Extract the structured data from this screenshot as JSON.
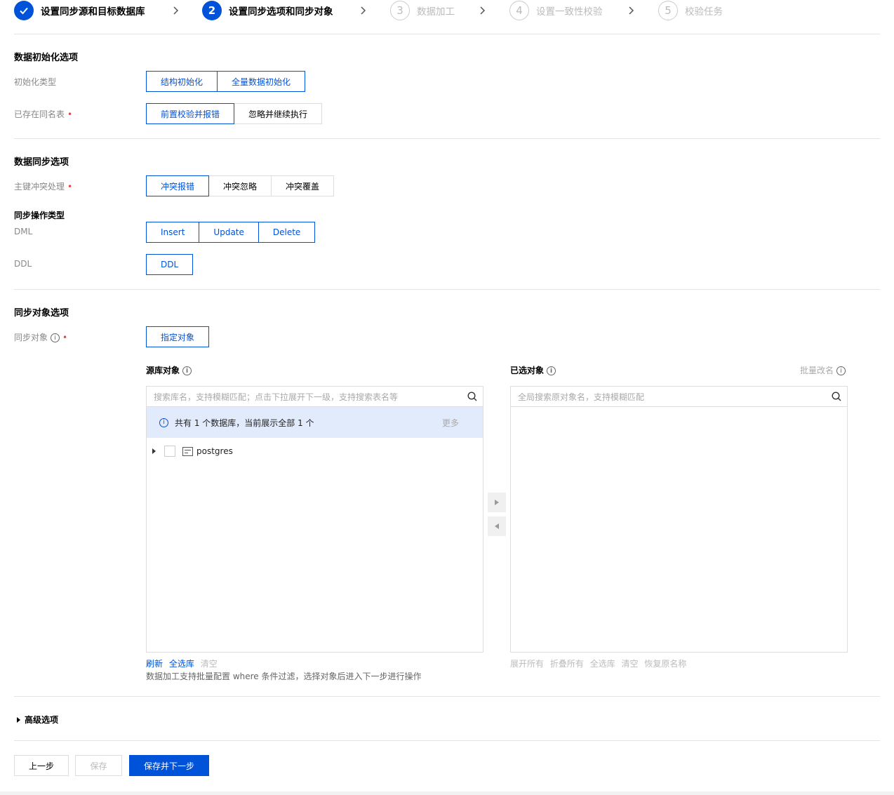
{
  "steps": [
    {
      "num": "✓",
      "label": "设置同步源和目标数据库",
      "state": "done"
    },
    {
      "num": "2",
      "label": "设置同步选项和同步对象",
      "state": "active"
    },
    {
      "num": "3",
      "label": "数据加工",
      "state": "todo"
    },
    {
      "num": "4",
      "label": "设置一致性校验",
      "state": "todo"
    },
    {
      "num": "5",
      "label": "校验任务",
      "state": "todo"
    }
  ],
  "init_section": {
    "title": "数据初始化选项",
    "init_type_label": "初始化类型",
    "init_type_options": [
      "结构初始化",
      "全量数据初始化"
    ],
    "existing_table_label": "已存在同名表",
    "existing_table_options": [
      "前置校验并报错",
      "忽略并继续执行"
    ]
  },
  "sync_section": {
    "title": "数据同步选项",
    "conflict_label": "主键冲突处理",
    "conflict_options": [
      "冲突报错",
      "冲突忽略",
      "冲突覆盖"
    ],
    "op_type_title": "同步操作类型",
    "dml_label": "DML",
    "dml_options": [
      "Insert",
      "Update",
      "Delete"
    ],
    "ddl_label": "DDL",
    "ddl_options": [
      "DDL"
    ]
  },
  "object_section": {
    "title": "同步对象选项",
    "object_label": "同步对象",
    "object_option": "指定对象",
    "source": {
      "title": "源库对象",
      "search_placeholder": "搜索库名，支持模糊匹配；点击下拉展开下一级，支持搜索表名等",
      "notice": "共有 1 个数据库，当前展示全部 1 个",
      "more": "更多",
      "tree_items": [
        "postgres"
      ],
      "actions": {
        "refresh": "刷新",
        "select_all": "全选库",
        "clear": "清空"
      },
      "hint": "数据加工支持批量配置 where 条件过滤，选择对象后进入下一步进行操作"
    },
    "selected": {
      "title": "已选对象",
      "batch_rename": "批量改名",
      "search_placeholder": "全局搜索原对象名，支持模糊匹配",
      "actions": {
        "expand_all": "展开所有",
        "collapse_all": "折叠所有",
        "select_all": "全选库",
        "clear": "清空",
        "restore": "恢复原名称"
      }
    }
  },
  "advanced": {
    "label": "高级选项"
  },
  "footer": {
    "prev": "上一步",
    "save": "保存",
    "save_next": "保存并下一步"
  },
  "colors": {
    "brand": "#0052d9",
    "notice_bg": "#e2ebfc",
    "required": "#e54545"
  },
  "icons": {
    "check": "check-icon",
    "chevron": "chevron-right-icon",
    "info": "info-icon",
    "search": "search-icon",
    "database": "database-icon"
  }
}
